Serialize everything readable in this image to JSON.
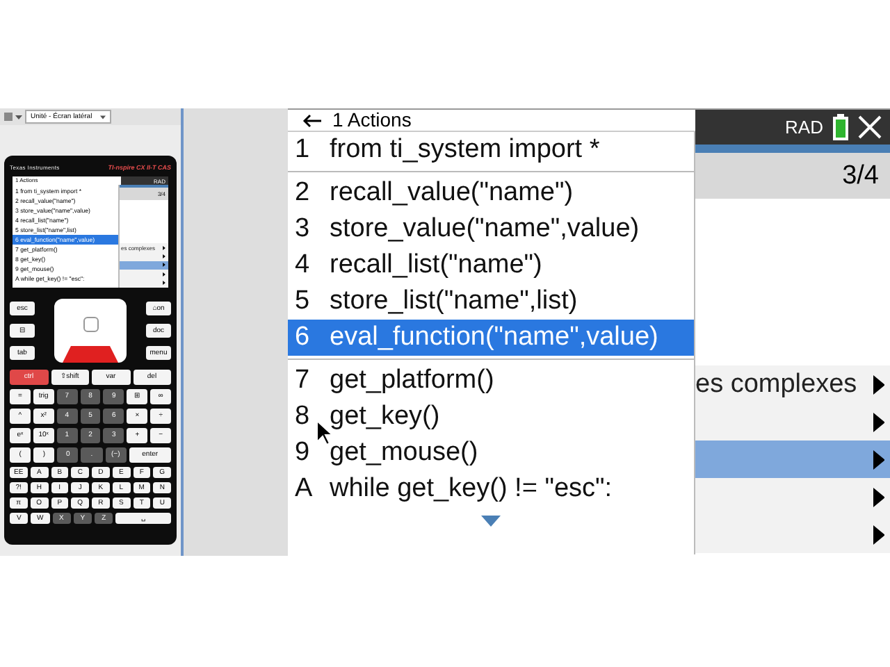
{
  "toolbar": {
    "dropdown": "Unité - Écran latéral"
  },
  "calculator": {
    "brand": "Texas Instruments",
    "model": "TI-nspire CX II-T CAS",
    "mini_screen": {
      "menu_title": "1 Actions",
      "mode": "RAD",
      "page": "3/4",
      "submenu": [
        {
          "text": "es complexes",
          "selected": false
        },
        {
          "selected": false
        },
        {
          "selected": true
        },
        {
          "selected": false
        },
        {
          "selected": false
        }
      ],
      "items": [
        {
          "number": "1",
          "text": "from ti_system import *",
          "selected": false
        },
        {
          "number": "2",
          "text": "recall_value(\"name\")",
          "selected": false
        },
        {
          "number": "3",
          "text": "store_value(\"name\",value)",
          "selected": false
        },
        {
          "number": "4",
          "text": "recall_list(\"name\")",
          "selected": false
        },
        {
          "number": "5",
          "text": "store_list(\"name\",list)",
          "selected": false
        },
        {
          "number": "6",
          "text": "eval_function(\"name\",value)",
          "selected": true
        },
        {
          "number": "7",
          "text": "get_platform()",
          "selected": false
        },
        {
          "number": "8",
          "text": "get_key()",
          "selected": false
        },
        {
          "number": "9",
          "text": "get_mouse()",
          "selected": false
        },
        {
          "number": "A",
          "text": "while get_key() != \"esc\":",
          "selected": false
        }
      ]
    },
    "nav_left": [
      {
        "label": "esc",
        "kind": "white"
      },
      {
        "label": "⊟",
        "kind": "white"
      },
      {
        "label": "tab",
        "kind": "white"
      }
    ],
    "nav_right": [
      {
        "label": "⌂on",
        "kind": "white"
      },
      {
        "label": "doc",
        "kind": "white"
      },
      {
        "label": "menu",
        "kind": "white"
      }
    ],
    "key_rows": [
      [
        {
          "label": "ctrl",
          "kind": "red"
        },
        {
          "label": "⇧shift",
          "kind": "white"
        },
        {
          "label": "var",
          "kind": "white"
        },
        {
          "label": "del",
          "kind": "white"
        }
      ],
      [
        {
          "label": "=",
          "kind": "white"
        },
        {
          "label": "trig",
          "kind": "white"
        },
        {
          "label": "7",
          "kind": "dark"
        },
        {
          "label": "8",
          "kind": "dark"
        },
        {
          "label": "9",
          "kind": "dark"
        },
        {
          "label": "⊞",
          "kind": "white"
        },
        {
          "label": "∞",
          "kind": "white"
        }
      ],
      [
        {
          "label": "^",
          "kind": "white"
        },
        {
          "label": "x²",
          "kind": "white"
        },
        {
          "label": "4",
          "kind": "dark"
        },
        {
          "label": "5",
          "kind": "dark"
        },
        {
          "label": "6",
          "kind": "dark"
        },
        {
          "label": "×",
          "kind": "white"
        },
        {
          "label": "÷",
          "kind": "white"
        }
      ],
      [
        {
          "label": "eˣ",
          "kind": "white"
        },
        {
          "label": "10ˣ",
          "kind": "white"
        },
        {
          "label": "1",
          "kind": "dark"
        },
        {
          "label": "2",
          "kind": "dark"
        },
        {
          "label": "3",
          "kind": "dark"
        },
        {
          "label": "+",
          "kind": "white"
        },
        {
          "label": "−",
          "kind": "white"
        }
      ],
      [
        {
          "label": "(",
          "kind": "white"
        },
        {
          "label": ")",
          "kind": "white"
        },
        {
          "label": "0",
          "kind": "dark"
        },
        {
          "label": ".",
          "kind": "dark"
        },
        {
          "label": "(−)",
          "kind": "dark"
        },
        {
          "label": "enter",
          "kind": "white"
        }
      ],
      [
        {
          "label": "EE",
          "kind": "white"
        },
        {
          "label": "A",
          "kind": "white"
        },
        {
          "label": "B",
          "kind": "white"
        },
        {
          "label": "C",
          "kind": "white"
        },
        {
          "label": "D",
          "kind": "white"
        },
        {
          "label": "E",
          "kind": "white"
        },
        {
          "label": "F",
          "kind": "white"
        },
        {
          "label": "G",
          "kind": "white"
        }
      ],
      [
        {
          "label": "?!",
          "kind": "white"
        },
        {
          "label": "H",
          "kind": "white"
        },
        {
          "label": "I",
          "kind": "white"
        },
        {
          "label": "J",
          "kind": "white"
        },
        {
          "label": "K",
          "kind": "white"
        },
        {
          "label": "L",
          "kind": "white"
        },
        {
          "label": "M",
          "kind": "white"
        },
        {
          "label": "N",
          "kind": "white"
        }
      ],
      [
        {
          "label": "π",
          "kind": "white"
        },
        {
          "label": "O",
          "kind": "white"
        },
        {
          "label": "P",
          "kind": "white"
        },
        {
          "label": "Q",
          "kind": "white"
        },
        {
          "label": "R",
          "kind": "white"
        },
        {
          "label": "S",
          "kind": "white"
        },
        {
          "label": "T",
          "kind": "white"
        },
        {
          "label": "U",
          "kind": "white"
        }
      ],
      [
        {
          "label": "V",
          "kind": "white"
        },
        {
          "label": "W",
          "kind": "white"
        },
        {
          "label": "X",
          "kind": "dark"
        },
        {
          "label": "Y",
          "kind": "dark"
        },
        {
          "label": "Z",
          "kind": "dark"
        },
        {
          "label": "␣",
          "kind": "white"
        }
      ]
    ]
  },
  "screen": {
    "menu_title": "1 Actions",
    "mode": "RAD",
    "page": "3/4",
    "submenu": [
      {
        "text": "es complexes",
        "selected": false
      },
      {
        "selected": false
      },
      {
        "selected": true
      },
      {
        "selected": false
      },
      {
        "selected": false
      }
    ],
    "popup": [
      {
        "number": "1",
        "text": "from ti_system import *",
        "selected": false
      },
      {
        "number": "2",
        "text": "recall_value(\"name\")",
        "selected": false
      },
      {
        "number": "3",
        "text": "store_value(\"name\",value)",
        "selected": false
      },
      {
        "number": "4",
        "text": "recall_list(\"name\")",
        "selected": false
      },
      {
        "number": "5",
        "text": "store_list(\"name\",list)",
        "selected": false
      },
      {
        "number": "6",
        "text": "eval_function(\"name\",value)",
        "selected": true
      },
      {
        "number": "7",
        "text": "get_platform()",
        "selected": false
      },
      {
        "number": "8",
        "text": "get_key()",
        "selected": false
      },
      {
        "number": "9",
        "text": "get_mouse()",
        "selected": false
      },
      {
        "number": "A",
        "text": "while get_key() != \"esc\":",
        "selected": false
      }
    ]
  }
}
